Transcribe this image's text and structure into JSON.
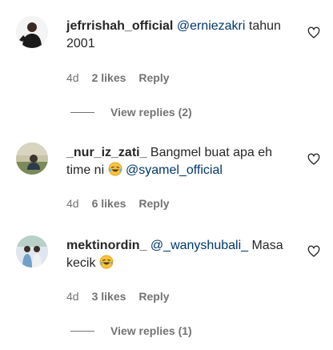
{
  "comments": [
    {
      "username": "jefrrishah_official",
      "mention": "@erniezakri",
      "text_after": " tahun 2001",
      "time": "4d",
      "likes": "2 likes",
      "reply": "Reply",
      "view_replies": "View replies (2)"
    },
    {
      "username": "_nur_iz_zati_",
      "text": " Bangmel buat apa eh time ni",
      "emoji": "laughing-tears-emoji",
      "mention": "@syamel_official",
      "time": "4d",
      "likes": "6 likes",
      "reply": "Reply"
    },
    {
      "username": "mektinordin_",
      "mention": "@_wanyshubali_",
      "text_after": " Masa kecik ",
      "emoji": "laughing-tears-emoji",
      "time": "4d",
      "likes": "3 likes",
      "reply": "Reply",
      "view_replies": "View replies (1)"
    }
  ],
  "icons": {
    "like": "heart-outline-icon"
  },
  "colors": {
    "text": "#262626",
    "secondary": "#737373",
    "mention": "#00376b"
  }
}
